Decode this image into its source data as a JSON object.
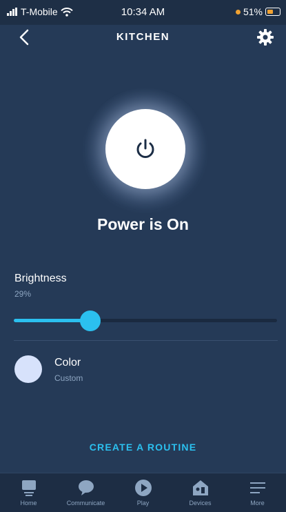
{
  "status_bar": {
    "carrier": "T-Mobile",
    "time": "10:34 AM",
    "battery": "51%"
  },
  "header": {
    "title": "KITCHEN"
  },
  "power": {
    "status_text": "Power is On"
  },
  "brightness": {
    "label": "Brightness",
    "value_text": "29%",
    "value": 29
  },
  "color": {
    "label": "Color",
    "value": "Custom",
    "swatch": "#d7e2fb"
  },
  "routine": {
    "label": "CREATE A ROUTINE"
  },
  "nav": {
    "items": [
      {
        "label": "Home",
        "icon": "home-icon"
      },
      {
        "label": "Communicate",
        "icon": "chat-bubble-icon"
      },
      {
        "label": "Play",
        "icon": "play-icon"
      },
      {
        "label": "Devices",
        "icon": "devices-icon"
      },
      {
        "label": "More",
        "icon": "menu-icon"
      }
    ]
  },
  "colors": {
    "background": "#253a57",
    "accent": "#2bc0ef",
    "muted_text": "#8ea6c2"
  }
}
